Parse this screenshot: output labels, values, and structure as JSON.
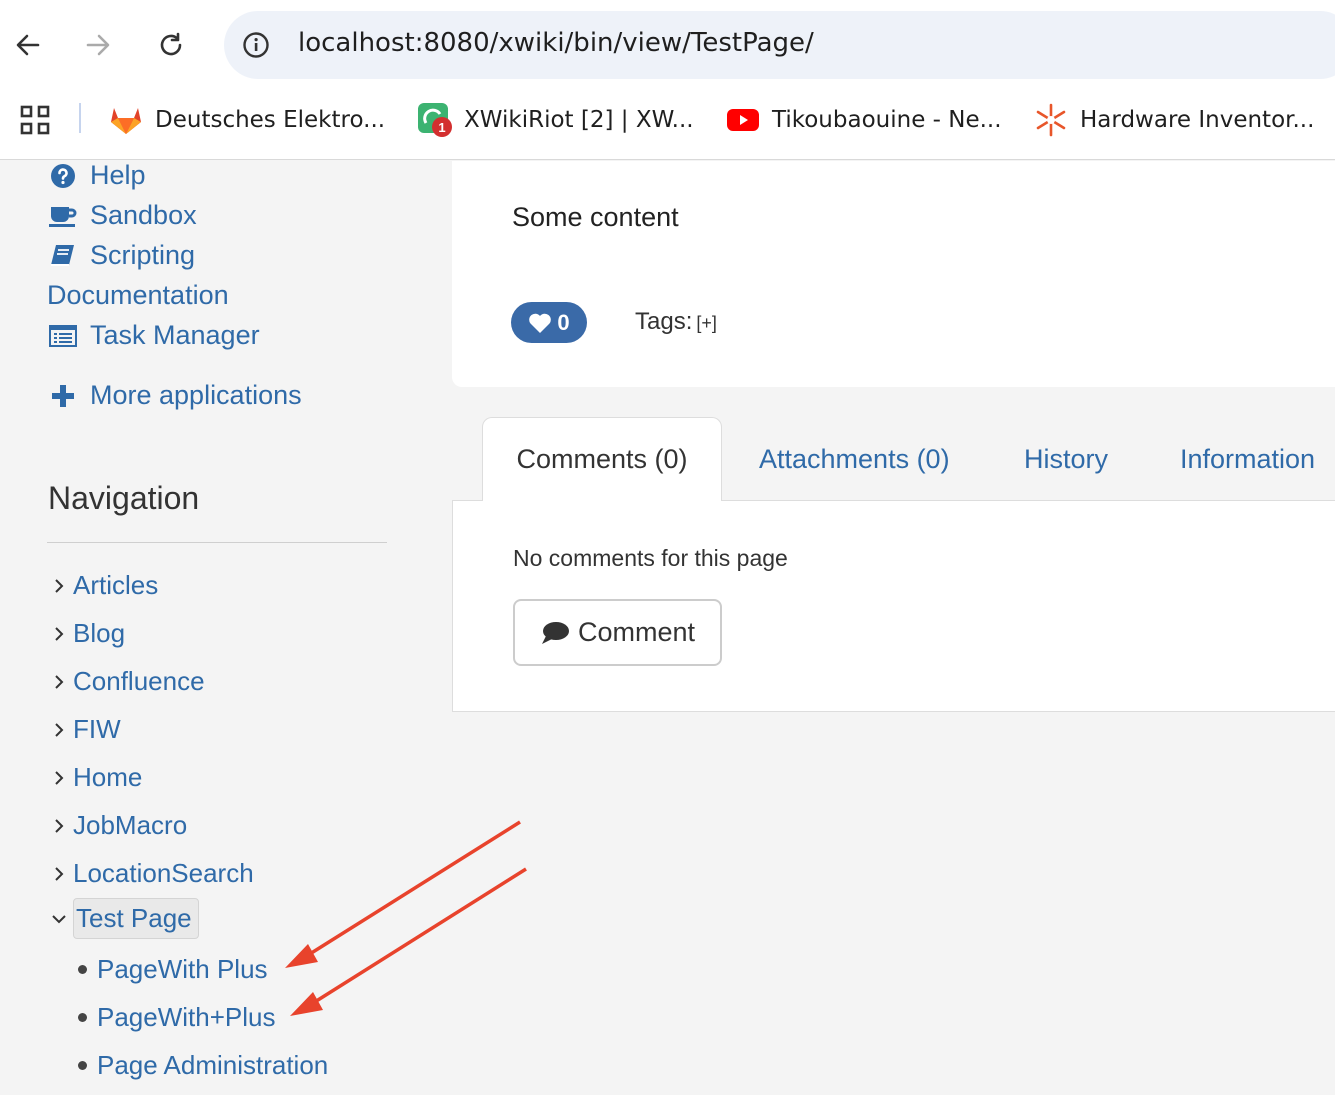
{
  "browser": {
    "url": "localhost:8080/xwiki/bin/view/TestPage/",
    "bookmarks": [
      {
        "label": "Deutsches Elektro...",
        "icon": "gitlab-icon"
      },
      {
        "label": "XWikiRiot [2] | XW...",
        "icon": "riot-icon",
        "badge": "1"
      },
      {
        "label": "Tikoubaouine - Ne...",
        "icon": "youtube-icon"
      },
      {
        "label": "Hardware Inventor...",
        "icon": "snowflake-icon"
      }
    ]
  },
  "sidebar": {
    "apps": [
      {
        "label": "Help",
        "icon": "question-circle-icon"
      },
      {
        "label": "Sandbox",
        "icon": "coffee-icon"
      },
      {
        "label": "Scripting",
        "icon": "book-icon"
      },
      {
        "label": "Documentation",
        "icon": ""
      },
      {
        "label": "Task Manager",
        "icon": "list-icon"
      }
    ],
    "more_apps": "More applications",
    "navigation_title": "Navigation",
    "tree": [
      {
        "label": "Articles"
      },
      {
        "label": "Blog"
      },
      {
        "label": "Confluence"
      },
      {
        "label": "FIW"
      },
      {
        "label": "Home"
      },
      {
        "label": "JobMacro"
      },
      {
        "label": "LocationSearch"
      },
      {
        "label": "Test Page",
        "expanded": true,
        "selected": true
      }
    ],
    "children": [
      {
        "label": "PageWith Plus"
      },
      {
        "label": "PageWith+Plus"
      },
      {
        "label": "Page Administration"
      }
    ]
  },
  "content": {
    "text": "Some content",
    "likes": "0",
    "tags_label": "Tags:",
    "tags_add": "[+]"
  },
  "tabs": [
    {
      "label": "Comments (0)",
      "active": true
    },
    {
      "label": "Attachments (0)"
    },
    {
      "label": "History"
    },
    {
      "label": "Information"
    }
  ],
  "comments": {
    "empty_text": "No comments for this page",
    "button_label": "Comment"
  },
  "colors": {
    "link": "#2f6aa8",
    "accent": "#3a6aa8",
    "annotation": "#e8432c"
  }
}
